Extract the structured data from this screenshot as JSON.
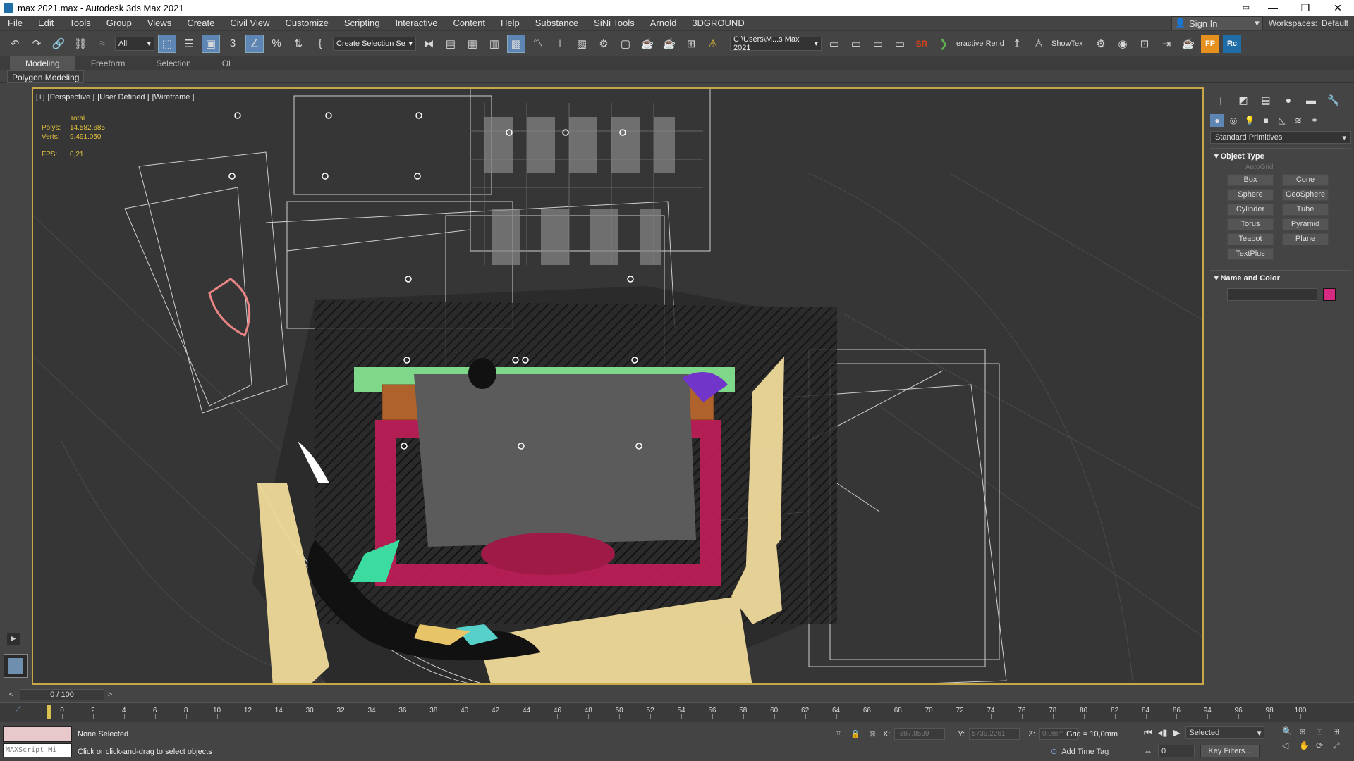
{
  "window": {
    "title": "max 2021.max - Autodesk 3ds Max 2021",
    "minimize": "—",
    "maximize": "❐",
    "close": "✕",
    "quick_access": "▭"
  },
  "menu": [
    "File",
    "Edit",
    "Tools",
    "Group",
    "Views",
    "Create",
    "Civil View",
    "Customize",
    "Scripting",
    "Interactive",
    "Content",
    "Help",
    "Substance",
    "SiNi Tools",
    "Arnold",
    "3DGROUND"
  ],
  "signin": {
    "label": "Sign In"
  },
  "workspaces": {
    "label": "Workspaces:",
    "value": "Default"
  },
  "toolbar": {
    "filter": "All",
    "named_selection": "Create Selection Se",
    "project_path": "C:\\Users\\M...s Max 2021",
    "interactive_render": "eractive Rend",
    "sr": "SR",
    "showtex": "ShowTex",
    "fp": "FP",
    "rc": "Rc"
  },
  "ribbon": {
    "tabs": [
      "Modeling",
      "Freeform",
      "Selection",
      "Ol"
    ],
    "active": "Modeling",
    "sub": "Polygon Modeling"
  },
  "viewport": {
    "labels": [
      "[+]",
      "[Perspective ]",
      "[User Defined ]",
      "[Wireframe ]"
    ],
    "stats": {
      "total": "Total",
      "polys_label": "Polys:",
      "polys": "14.582.685",
      "verts_label": "Verts:",
      "verts": "9.491.050",
      "fps_label": "FPS:",
      "fps": "0,21"
    }
  },
  "command_panel": {
    "category": "Standard Primitives",
    "object_type_title": "Object Type",
    "autogrid": "AutoGrid",
    "buttons": [
      "Box",
      "Cone",
      "Sphere",
      "GeoSphere",
      "Cylinder",
      "Tube",
      "Torus",
      "Pyramid",
      "Teapot",
      "Plane",
      "TextPlus"
    ],
    "name_color_title": "Name and Color",
    "object_color": "#d62b80"
  },
  "time_slider": {
    "label": "0 / 100"
  },
  "track_labels": [
    "0",
    "2",
    "4",
    "6",
    "8",
    "10",
    "12",
    "14",
    "30",
    "32",
    "34",
    "36",
    "38",
    "40",
    "42",
    "44",
    "46",
    "48",
    "50",
    "52",
    "54",
    "56",
    "58",
    "60",
    "62",
    "64",
    "66",
    "68",
    "70",
    "72",
    "74",
    "76",
    "78",
    "80",
    "82",
    "84",
    "86",
    "94",
    "96",
    "98",
    "100"
  ],
  "status": {
    "selection": "None Selected",
    "prompt": "Click or click-and-drag to select objects",
    "maxscript": "MAXScript Mi",
    "x_label": "X:",
    "x": "-397,8599",
    "y_label": "Y:",
    "y": "5739,2261",
    "z_label": "Z:",
    "z": "0,0mm",
    "grid": "Grid = 10,0mm",
    "add_time_tag": "Add Time Tag",
    "selected_set": "Selected",
    "frame": "0",
    "key_filters": "Key Filters..."
  }
}
